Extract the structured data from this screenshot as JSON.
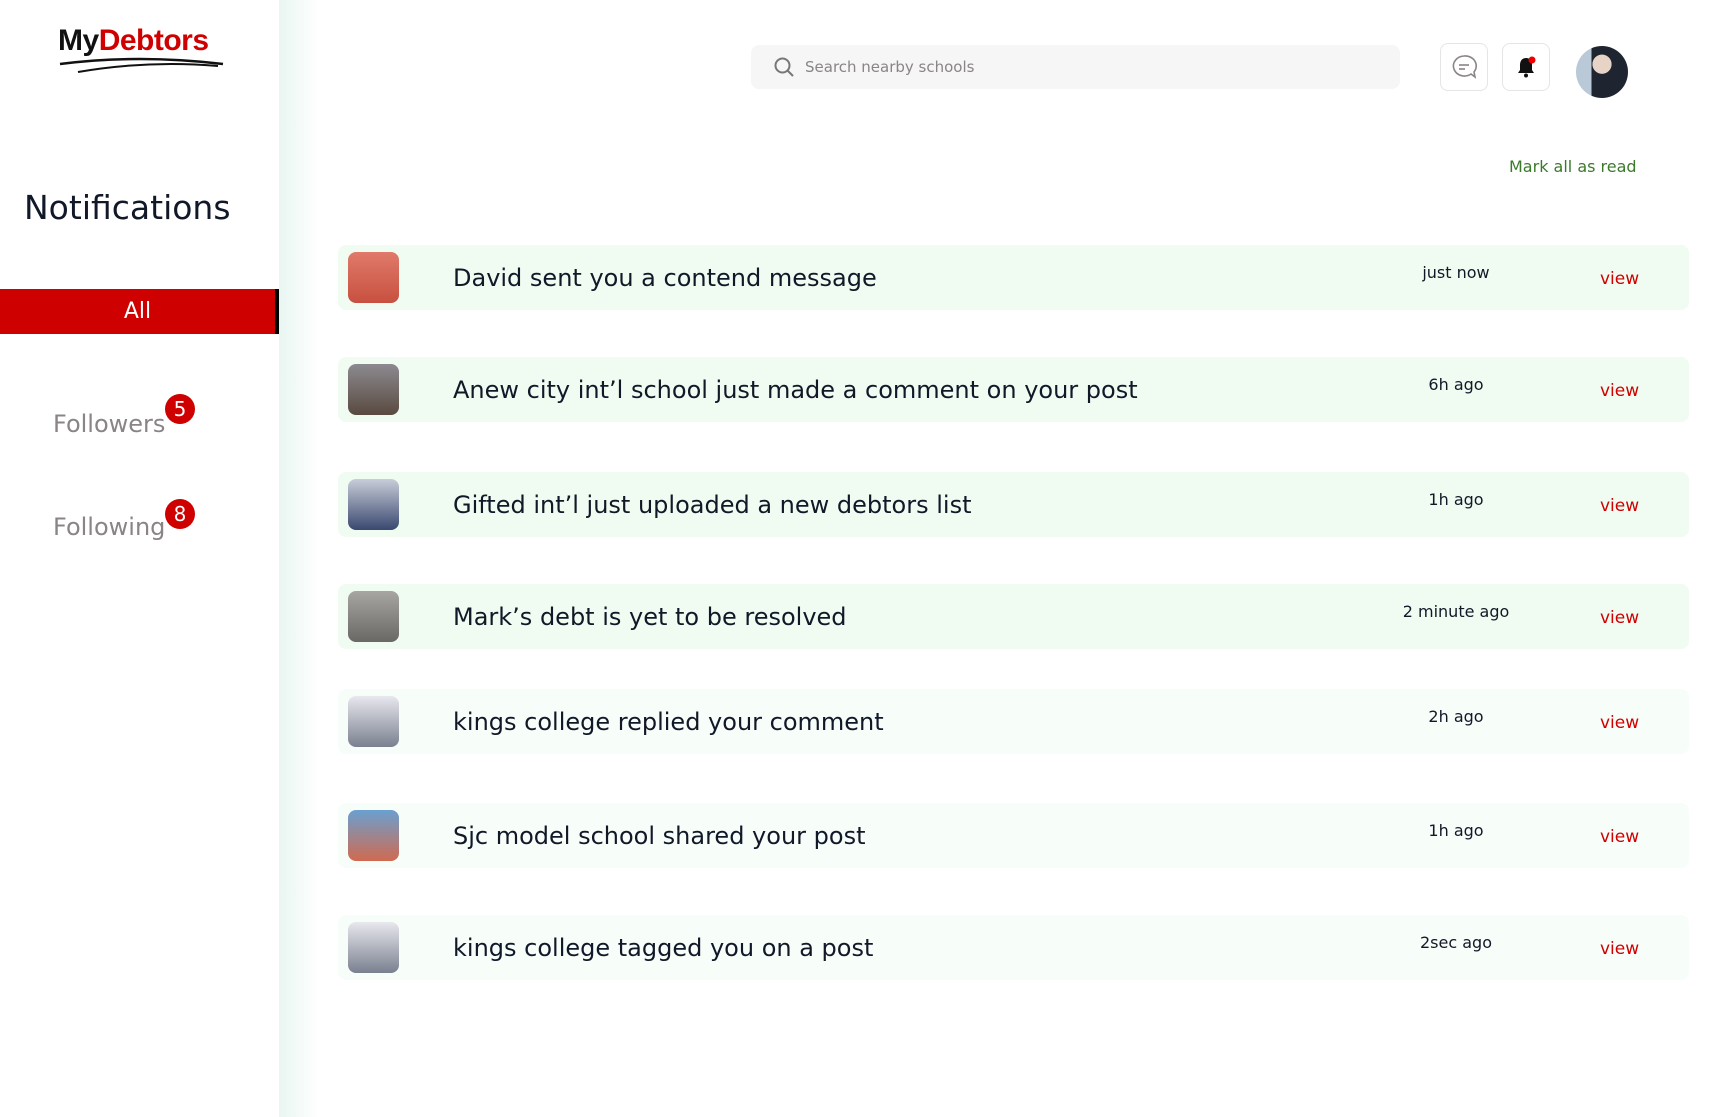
{
  "logo": {
    "text_my": "My",
    "text_debtors": "Debtors"
  },
  "sidebar": {
    "title": "Notifications",
    "tabs": [
      {
        "label": "All",
        "active": true
      },
      {
        "label": "Followers",
        "badge": "5"
      },
      {
        "label": "Following",
        "badge": "8"
      }
    ]
  },
  "header": {
    "search_placeholder": "Search nearby schools",
    "icons": [
      "chat-icon",
      "bell-icon"
    ],
    "bell_has_dot": true
  },
  "mark_all": "Mark all as read",
  "colors": {
    "accent": "#cf0000",
    "link_green": "#3a7a2a",
    "unread_bg": "#f0fcf2"
  },
  "notifications": [
    {
      "text": "David sent you a contend message",
      "time": "just now",
      "action": "view",
      "unread": true
    },
    {
      "text": "Anew city int’l school just made a comment on your post",
      "time": "6h ago",
      "action": "view",
      "unread": true
    },
    {
      "text": "Gifted int’l just uploaded a new debtors list",
      "time": "1h ago",
      "action": "view",
      "unread": true
    },
    {
      "text": "Mark’s debt is yet to be resolved",
      "time": "2 minute ago",
      "action": "view",
      "unread": true
    },
    {
      "text": "kings college replied your comment",
      "time": "2h ago",
      "action": "view",
      "unread": false
    },
    {
      "text": "Sjc model school shared your post",
      "time": "1h ago",
      "action": "view",
      "unread": false
    },
    {
      "text": "kings college tagged you on a post",
      "time": "2sec ago",
      "action": "view",
      "unread": false
    }
  ]
}
